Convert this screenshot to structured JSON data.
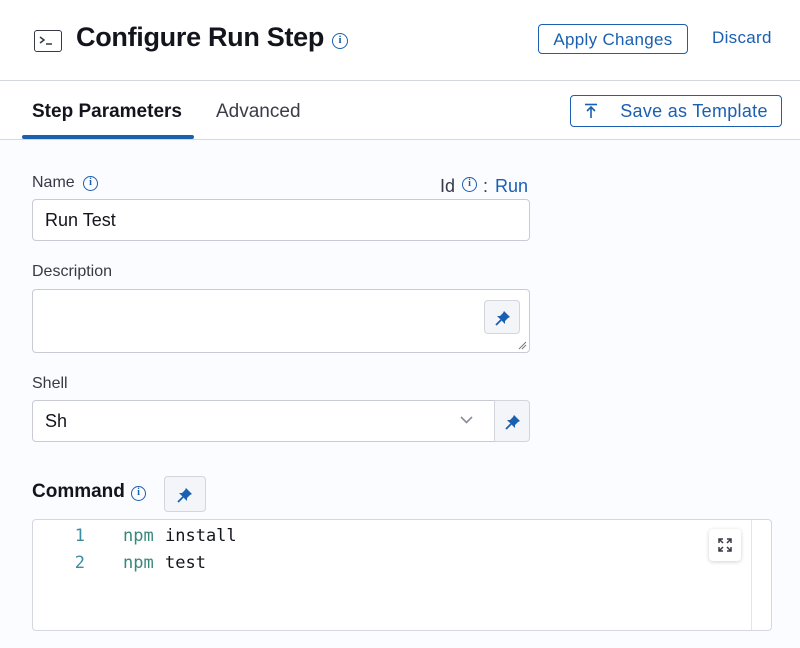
{
  "header": {
    "title": "Configure Run Step",
    "icon": "terminal-icon",
    "apply_label": "Apply Changes",
    "discard_label": "Discard"
  },
  "tabs": {
    "items": [
      {
        "label": "Step Parameters",
        "active": true
      },
      {
        "label": "Advanced",
        "active": false
      }
    ],
    "save_template_label": "Save as Template"
  },
  "form": {
    "name": {
      "label": "Name",
      "value": "Run Test"
    },
    "id": {
      "label": "Id",
      "sep": ":",
      "value": "Run"
    },
    "description": {
      "label": "Description",
      "value": ""
    },
    "shell": {
      "label": "Shell",
      "value": "Sh"
    },
    "command": {
      "label": "Command",
      "lines": [
        {
          "num": "1",
          "cmd": "npm",
          "arg": "install"
        },
        {
          "num": "2",
          "cmd": "npm",
          "arg": "test"
        }
      ]
    }
  },
  "colors": {
    "accent": "#1b5fb1",
    "background": "#fafcff",
    "code_keyword": "#37877a"
  }
}
